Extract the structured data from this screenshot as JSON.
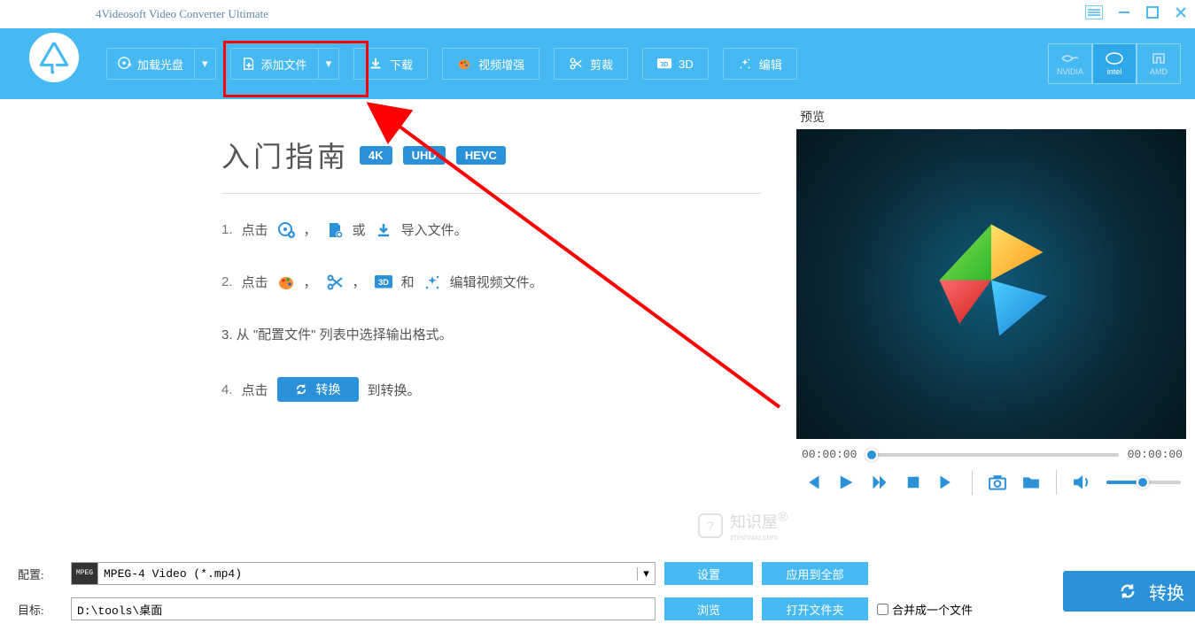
{
  "app": {
    "title": "4Videosoft Video Converter Ultimate"
  },
  "toolbar": {
    "load_disc": "加载光盘",
    "add_file": "添加文件",
    "download": "下载",
    "enhance": "视频增强",
    "trim": "剪裁",
    "three_d": "3D",
    "edit": "编辑"
  },
  "tech": {
    "nvidia": "NVIDIA",
    "intel": "intel",
    "amd": "AMD"
  },
  "guide": {
    "title": "入门指南",
    "badge_4k": "4K",
    "badge_uhd": "UHD",
    "badge_hevc": "HEVC",
    "step1_a": "1.",
    "step1_b": "点击",
    "step1_sep1": "，",
    "step1_or": "或",
    "step1_tail": "导入文件。",
    "step2_a": "2.",
    "step2_b": "点击",
    "step2_sep1": "，",
    "step2_sep2": "，",
    "step2_and": "和",
    "step2_tail": "编辑视频文件。",
    "step3": "3.  从 \"配置文件\" 列表中选择输出格式。",
    "step4_a": "4.",
    "step4_b": "点击",
    "step4_convert": "转换",
    "step4_tail": "到转换。"
  },
  "watermark": {
    "cn": "知识屋",
    "en": "zhishiwu.com",
    "reg": "®"
  },
  "preview": {
    "label": "预览",
    "time_current": "00:00:00",
    "time_total": "00:00:00"
  },
  "bottom": {
    "profile_label": "配置:",
    "profile_value": "MPEG-4 Video (*.mp4)",
    "profile_codec": "MPEG",
    "settings": "设置",
    "apply_all": "应用到全部",
    "dest_label": "目标:",
    "dest_value": "D:\\tools\\桌面",
    "browse": "浏览",
    "open_folder": "打开文件夹",
    "merge": "合并成一个文件",
    "convert": "转换"
  }
}
